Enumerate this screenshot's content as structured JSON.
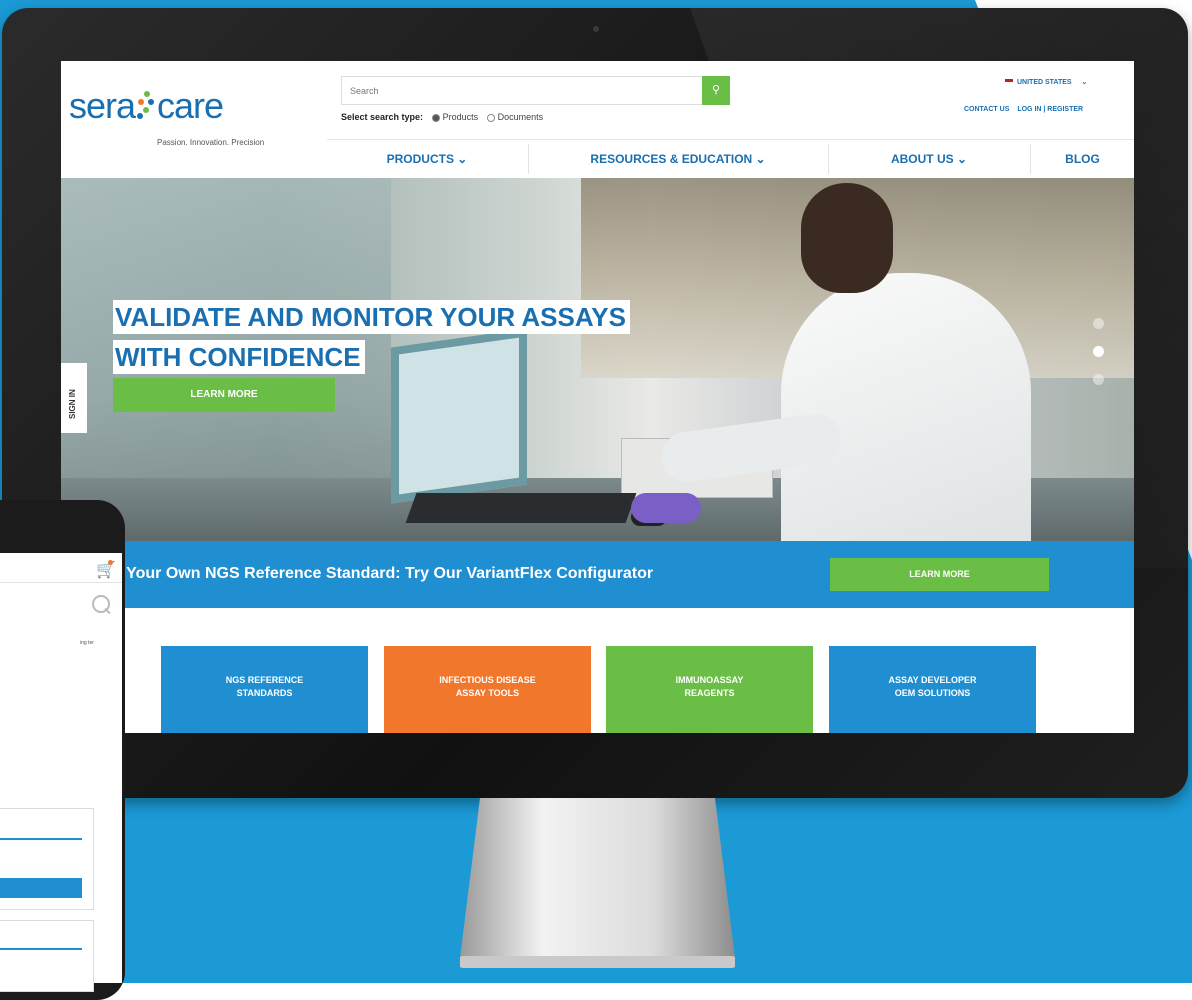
{
  "colors": {
    "background": "#1b9ad6",
    "brand_blue": "#1a6fb0",
    "accent_green": "#6abd45",
    "accent_orange": "#f0772b",
    "banner_blue": "#1f8fd1"
  },
  "header": {
    "logo_sera": "sera",
    "logo_care": "care",
    "tagline": "Passion. Innovation. Precision",
    "search": {
      "placeholder": "Search",
      "button_icon": "search-icon",
      "type_label": "Select search type:",
      "options": [
        "Products",
        "Documents"
      ],
      "selected": "Products"
    },
    "country": "UNITED STATES",
    "contact": "CONTACT US",
    "login": "LOG IN | REGISTER"
  },
  "nav": {
    "products": "PRODUCTS ⌄",
    "resources": "RESOURCES & EDUCATION ⌄",
    "about": "ABOUT US ⌄",
    "blog": "BLOG"
  },
  "hero": {
    "title_line1": "VALIDATE AND MONITOR YOUR ASSAYS",
    "title_line2": "WITH CONFIDENCE",
    "button": "LEARN MORE",
    "sign_in": "SIGN IN"
  },
  "banner": {
    "text": "Build Your Own NGS Reference Standard: Try Our VariantFlex Configurator",
    "button": "LEARN MORE"
  },
  "tiles": [
    {
      "label": "NGS REFERENCE\nSTANDARDS",
      "color": "#1f8fd1"
    },
    {
      "label": "INFECTIOUS DISEASE\nASSAY TOOLS",
      "color": "#f0772b"
    },
    {
      "label": "IMMUNOASSAY\nREAGENTS",
      "color": "#6abd45"
    },
    {
      "label": "ASSAY DEVELOPER\nOEM SOLUTIONS",
      "color": "#1f8fd1"
    }
  ],
  "phone": {
    "cart_icon": "cart-icon",
    "search_icon": "search-icon",
    "snippet": "ing ter"
  }
}
